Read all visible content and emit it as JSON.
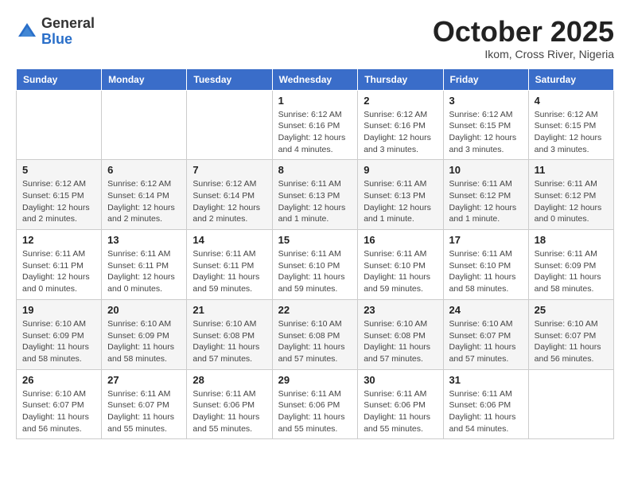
{
  "logo": {
    "general": "General",
    "blue": "Blue"
  },
  "header": {
    "month": "October 2025",
    "location": "Ikom, Cross River, Nigeria"
  },
  "weekdays": [
    "Sunday",
    "Monday",
    "Tuesday",
    "Wednesday",
    "Thursday",
    "Friday",
    "Saturday"
  ],
  "weeks": [
    [
      {
        "day": "",
        "info": ""
      },
      {
        "day": "",
        "info": ""
      },
      {
        "day": "",
        "info": ""
      },
      {
        "day": "1",
        "info": "Sunrise: 6:12 AM\nSunset: 6:16 PM\nDaylight: 12 hours\nand 4 minutes."
      },
      {
        "day": "2",
        "info": "Sunrise: 6:12 AM\nSunset: 6:16 PM\nDaylight: 12 hours\nand 3 minutes."
      },
      {
        "day": "3",
        "info": "Sunrise: 6:12 AM\nSunset: 6:15 PM\nDaylight: 12 hours\nand 3 minutes."
      },
      {
        "day": "4",
        "info": "Sunrise: 6:12 AM\nSunset: 6:15 PM\nDaylight: 12 hours\nand 3 minutes."
      }
    ],
    [
      {
        "day": "5",
        "info": "Sunrise: 6:12 AM\nSunset: 6:15 PM\nDaylight: 12 hours\nand 2 minutes."
      },
      {
        "day": "6",
        "info": "Sunrise: 6:12 AM\nSunset: 6:14 PM\nDaylight: 12 hours\nand 2 minutes."
      },
      {
        "day": "7",
        "info": "Sunrise: 6:12 AM\nSunset: 6:14 PM\nDaylight: 12 hours\nand 2 minutes."
      },
      {
        "day": "8",
        "info": "Sunrise: 6:11 AM\nSunset: 6:13 PM\nDaylight: 12 hours\nand 1 minute."
      },
      {
        "day": "9",
        "info": "Sunrise: 6:11 AM\nSunset: 6:13 PM\nDaylight: 12 hours\nand 1 minute."
      },
      {
        "day": "10",
        "info": "Sunrise: 6:11 AM\nSunset: 6:12 PM\nDaylight: 12 hours\nand 1 minute."
      },
      {
        "day": "11",
        "info": "Sunrise: 6:11 AM\nSunset: 6:12 PM\nDaylight: 12 hours\nand 0 minutes."
      }
    ],
    [
      {
        "day": "12",
        "info": "Sunrise: 6:11 AM\nSunset: 6:11 PM\nDaylight: 12 hours\nand 0 minutes."
      },
      {
        "day": "13",
        "info": "Sunrise: 6:11 AM\nSunset: 6:11 PM\nDaylight: 12 hours\nand 0 minutes."
      },
      {
        "day": "14",
        "info": "Sunrise: 6:11 AM\nSunset: 6:11 PM\nDaylight: 11 hours\nand 59 minutes."
      },
      {
        "day": "15",
        "info": "Sunrise: 6:11 AM\nSunset: 6:10 PM\nDaylight: 11 hours\nand 59 minutes."
      },
      {
        "day": "16",
        "info": "Sunrise: 6:11 AM\nSunset: 6:10 PM\nDaylight: 11 hours\nand 59 minutes."
      },
      {
        "day": "17",
        "info": "Sunrise: 6:11 AM\nSunset: 6:10 PM\nDaylight: 11 hours\nand 58 minutes."
      },
      {
        "day": "18",
        "info": "Sunrise: 6:11 AM\nSunset: 6:09 PM\nDaylight: 11 hours\nand 58 minutes."
      }
    ],
    [
      {
        "day": "19",
        "info": "Sunrise: 6:10 AM\nSunset: 6:09 PM\nDaylight: 11 hours\nand 58 minutes."
      },
      {
        "day": "20",
        "info": "Sunrise: 6:10 AM\nSunset: 6:09 PM\nDaylight: 11 hours\nand 58 minutes."
      },
      {
        "day": "21",
        "info": "Sunrise: 6:10 AM\nSunset: 6:08 PM\nDaylight: 11 hours\nand 57 minutes."
      },
      {
        "day": "22",
        "info": "Sunrise: 6:10 AM\nSunset: 6:08 PM\nDaylight: 11 hours\nand 57 minutes."
      },
      {
        "day": "23",
        "info": "Sunrise: 6:10 AM\nSunset: 6:08 PM\nDaylight: 11 hours\nand 57 minutes."
      },
      {
        "day": "24",
        "info": "Sunrise: 6:10 AM\nSunset: 6:07 PM\nDaylight: 11 hours\nand 57 minutes."
      },
      {
        "day": "25",
        "info": "Sunrise: 6:10 AM\nSunset: 6:07 PM\nDaylight: 11 hours\nand 56 minutes."
      }
    ],
    [
      {
        "day": "26",
        "info": "Sunrise: 6:10 AM\nSunset: 6:07 PM\nDaylight: 11 hours\nand 56 minutes."
      },
      {
        "day": "27",
        "info": "Sunrise: 6:11 AM\nSunset: 6:07 PM\nDaylight: 11 hours\nand 55 minutes."
      },
      {
        "day": "28",
        "info": "Sunrise: 6:11 AM\nSunset: 6:06 PM\nDaylight: 11 hours\nand 55 minutes."
      },
      {
        "day": "29",
        "info": "Sunrise: 6:11 AM\nSunset: 6:06 PM\nDaylight: 11 hours\nand 55 minutes."
      },
      {
        "day": "30",
        "info": "Sunrise: 6:11 AM\nSunset: 6:06 PM\nDaylight: 11 hours\nand 55 minutes."
      },
      {
        "day": "31",
        "info": "Sunrise: 6:11 AM\nSunset: 6:06 PM\nDaylight: 11 hours\nand 54 minutes."
      },
      {
        "day": "",
        "info": ""
      }
    ]
  ]
}
